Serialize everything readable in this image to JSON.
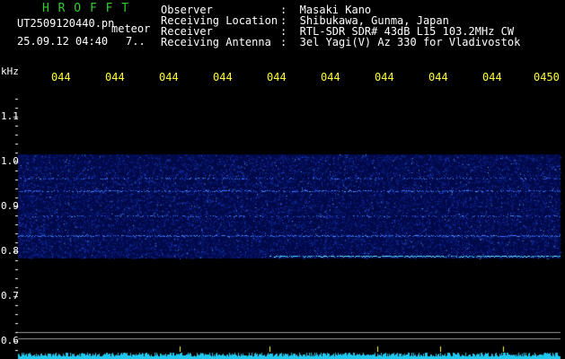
{
  "header": {
    "app_title": "H R O F F T",
    "filename": "UT2509120440.pn",
    "meteor_label": "meteor",
    "datetime": "25.09.12 04:40",
    "count": "7..",
    "info": [
      {
        "label": "Observer",
        "value": ":  Masaki Kano"
      },
      {
        "label": "Receiving Location",
        "value": ":  Shibukawa, Gunma, Japan"
      },
      {
        "label": "Receiver",
        "value": ":  RTL-SDR SDR# 43dB L15 103.2MHz CW"
      },
      {
        "label": "Receiving Antenna",
        "value": ":  3el Yagi(V) Az 330 for Vladivostok"
      }
    ]
  },
  "time_axis": {
    "labels": [
      "044",
      "044",
      "044",
      "044",
      "044",
      "044",
      "044",
      "044",
      "044",
      "0450"
    ]
  },
  "freq_axis": {
    "unit": "kHz",
    "labels": [
      "1.1",
      "1.0",
      "0.9",
      "0.8",
      "0.7",
      "0.6"
    ]
  },
  "colors": {
    "title": "#33cc33",
    "header_text": "#ffffff",
    "axis_text": "#ffff33",
    "signal": "#2f5fff",
    "bright": "#40e0ff",
    "divider": "#9a9a9a"
  }
}
